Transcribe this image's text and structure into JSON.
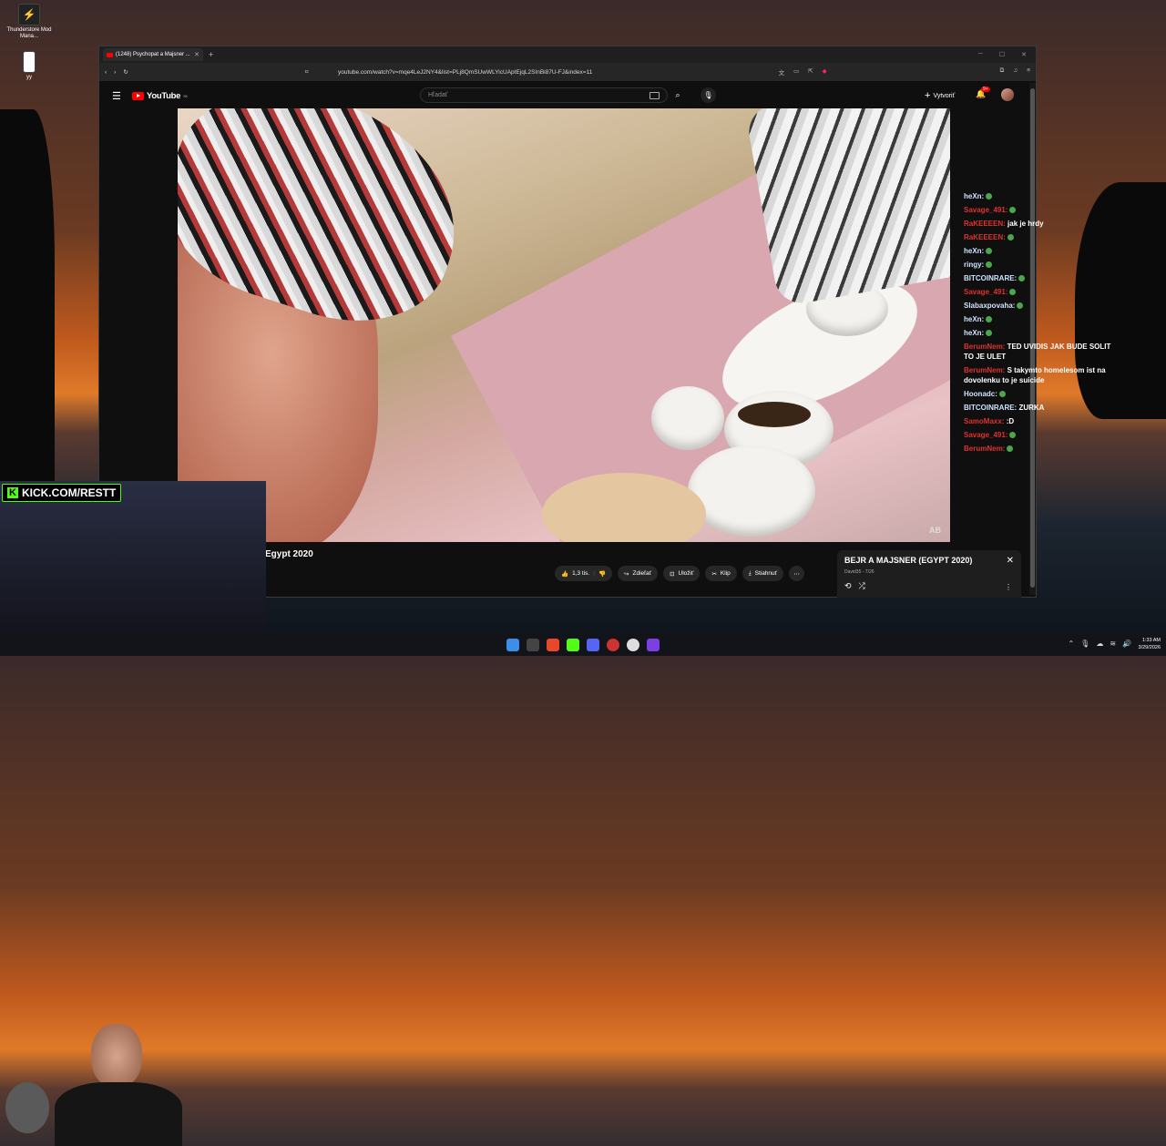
{
  "desktop": {
    "icons": [
      {
        "label": "Thunderstore Mod Mana...",
        "icon": "thunderstore-icon"
      },
      {
        "label": "yy",
        "icon": "file-icon"
      }
    ]
  },
  "browser": {
    "tab_title": "(1248) Psychopat a Majsner ...",
    "url": "youtube.com/watch?v=mqe4LeJ2NY4&list=PLj8QmSUwWLYicUAptEjqL2SInBi87U-FJ&index=11"
  },
  "youtube": {
    "logo": "YouTube",
    "logo_region": "SK",
    "search_placeholder": "Hľadať",
    "create_label": "Vytvoriť",
    "notif_count": "9+",
    "video_title": "Egypt 2020",
    "actions": {
      "like": "1,3 tis.",
      "share": "Zdieľať",
      "save": "Uložiť",
      "clip": "Klip",
      "download": "Stiahnuť"
    },
    "playlist": {
      "title": "BEJR A MAJSNER (EGYPT 2020)",
      "subtitle": "David35 - 7/26"
    },
    "watermark": "AB"
  },
  "chat": [
    {
      "user": "heXn:",
      "msg": "",
      "ucolor": "blue"
    },
    {
      "user": "Savage_491:",
      "msg": "",
      "ucolor": "red"
    },
    {
      "user": "RaKEEEEN:",
      "msg": "jak je hrdy",
      "ucolor": "red"
    },
    {
      "user": "RaKEEEEN:",
      "msg": "",
      "ucolor": "red"
    },
    {
      "user": "heXn:",
      "msg": "",
      "ucolor": "blue"
    },
    {
      "user": "ringy:",
      "msg": "",
      "ucolor": "blue"
    },
    {
      "user": "BITCOINRARE:",
      "msg": "",
      "ucolor": "blue"
    },
    {
      "user": "Savage_491:",
      "msg": "",
      "ucolor": "red"
    },
    {
      "user": "Slabaxpovaha:",
      "msg": "",
      "ucolor": "blue"
    },
    {
      "user": "heXn:",
      "msg": "",
      "ucolor": "blue"
    },
    {
      "user": "heXn:",
      "msg": "",
      "ucolor": "blue"
    },
    {
      "user": "BerumNem:",
      "msg": "TED UVIDIS JAK BUDE SOLIT TO JE ULET",
      "ucolor": "red"
    },
    {
      "user": "BerumNem:",
      "msg": "S takymto homelesom ist na dovolenku to je suicide",
      "ucolor": "red"
    },
    {
      "user": "Hoonadc:",
      "msg": "",
      "ucolor": "blue"
    },
    {
      "user": "BITCOINRARE:",
      "msg": "ZURKA",
      "ucolor": "blue"
    },
    {
      "user": "SamoMaxx:",
      "msg": ":D",
      "ucolor": "red"
    },
    {
      "user": "Savage_491:",
      "msg": "",
      "ucolor": "red"
    },
    {
      "user": "BerumNem:",
      "msg": "",
      "ucolor": "red"
    }
  ],
  "stream": {
    "kick_text": "KICK.COM/RESTT"
  },
  "taskbar": {
    "time": "1:33 AM",
    "date": "3/29/2026"
  },
  "colors": {
    "youtube_red": "#ff0000",
    "kick_green": "#53fc18",
    "chat_name_red": "#e0322f"
  }
}
